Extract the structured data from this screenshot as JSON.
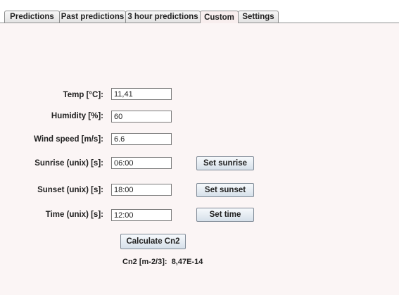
{
  "tabs": [
    {
      "label": "Predictions"
    },
    {
      "label": "Past predictions"
    },
    {
      "label": "3 hour predictions"
    },
    {
      "label": "Custom",
      "active": true
    },
    {
      "label": "Settings"
    }
  ],
  "form": {
    "temp": {
      "label": "Temp [°C]:",
      "value": "11,41"
    },
    "humidity": {
      "label": "Humidity [%]:",
      "value": "60"
    },
    "wind": {
      "label": "Wind speed [m/s]:",
      "value": "6.6"
    },
    "sunrise": {
      "label": "Sunrise (unix) [s]:",
      "value": "06:00",
      "button": "Set sunrise"
    },
    "sunset": {
      "label": "Sunset (unix) [s]:",
      "value": "18:00",
      "button": "Set sunset"
    },
    "time": {
      "label": "Time (unix) [s]:",
      "value": "12:00",
      "button": "Set time"
    }
  },
  "calculate_label": "Calculate Cn2",
  "result": {
    "label": "Cn2 [m-2/3]:",
    "value": "8,47E-14"
  }
}
